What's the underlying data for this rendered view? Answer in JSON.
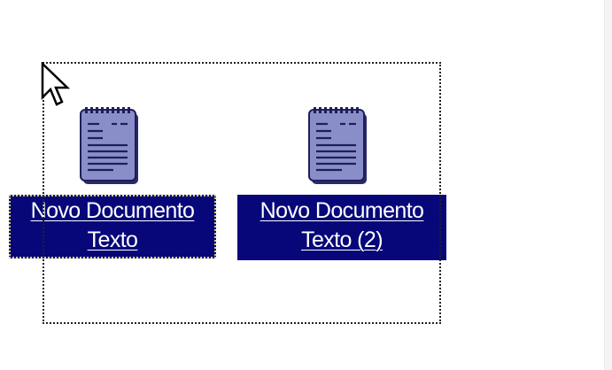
{
  "desktop": {
    "items": [
      {
        "label_line1": "Novo Documento",
        "label_line2": "Texto",
        "icon": "text-document-icon"
      },
      {
        "label_line1": "Novo Documento",
        "label_line2": "Texto (2)",
        "icon": "text-document-icon"
      }
    ]
  },
  "colors": {
    "selection_bg": "#07077a",
    "icon_fill": "#8a8ec8",
    "icon_dark": "#1e1e5a",
    "background": "#ffffff"
  },
  "cursor": "arrow-pointer-icon"
}
